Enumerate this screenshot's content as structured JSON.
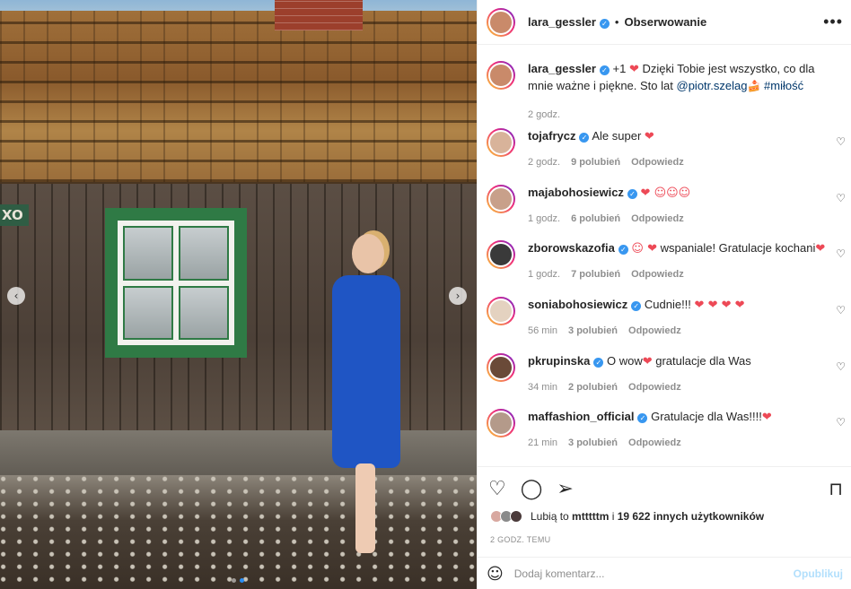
{
  "post": {
    "author": "lara_gessler",
    "follow_status": "Obserwowanie",
    "separator": "•",
    "more_icon": "more-horizontal-icon",
    "photo_alt": "",
    "carousel_dot_count": 2
  },
  "caption": {
    "username": "lara_gessler",
    "text_pre": "+1",
    "text_main": "Dzięki Tobie jest wszystko, co dla mnie ważne i piękne. Sto lat",
    "mention": "@piotr.szelag",
    "hashtag": "#miłość",
    "time": "2 godz."
  },
  "comments": [
    {
      "user": "tojafrycz",
      "text": "Ale super",
      "suffix": "❤",
      "time": "2 godz.",
      "likes": "9 polubień",
      "reply": "Odpowiedz",
      "avatar_color": "#d8b39a"
    },
    {
      "user": "majabohosiewicz",
      "text": "",
      "suffix": "❤ ☺☺☺",
      "time": "1 godz.",
      "likes": "6 polubień",
      "reply": "Odpowiedz",
      "avatar_color": "#c8a08a"
    },
    {
      "user": "zborowskazofia",
      "text": "wspaniale! Gratulacje kochani",
      "prefix": "☺ ❤",
      "suffix": "❤",
      "time": "1 godz.",
      "likes": "7 polubień",
      "reply": "Odpowiedz",
      "avatar_color": "#3a3a3a"
    },
    {
      "user": "soniabohosiewicz",
      "text": "Cudnie!!!",
      "suffix": "❤ ❤ ❤ ❤",
      "time": "56 min",
      "likes": "3 polubień",
      "reply": "Odpowiedz",
      "avatar_color": "#e4d2c0"
    },
    {
      "user": "pkrupinska",
      "text": "O wow",
      "suffix": "❤",
      "text2": "gratulacje dla Was",
      "time": "34 min",
      "likes": "2 polubień",
      "reply": "Odpowiedz",
      "avatar_color": "#6a4a38"
    },
    {
      "user": "maffashion_official",
      "text": "Gratulacje dla Was!!!!",
      "suffix": "❤",
      "time": "21 min",
      "likes": "3 polubień",
      "reply": "Odpowiedz",
      "avatar_color": "#b49a8a"
    }
  ],
  "actions": {
    "likes_prefix": "Lubią to",
    "likes_user": "mtttttm",
    "likes_mid": "i",
    "likes_count": "19 622 innych użytkowników",
    "time_ago": "2 GODZ. TEMU"
  },
  "composer": {
    "placeholder": "Dodaj komentarz...",
    "post_label": "Opublikuj"
  },
  "colors": {
    "verified": "#3897f0",
    "heart": "#ed4956",
    "link": "#00376b",
    "post_disabled": "#b2dffc"
  }
}
